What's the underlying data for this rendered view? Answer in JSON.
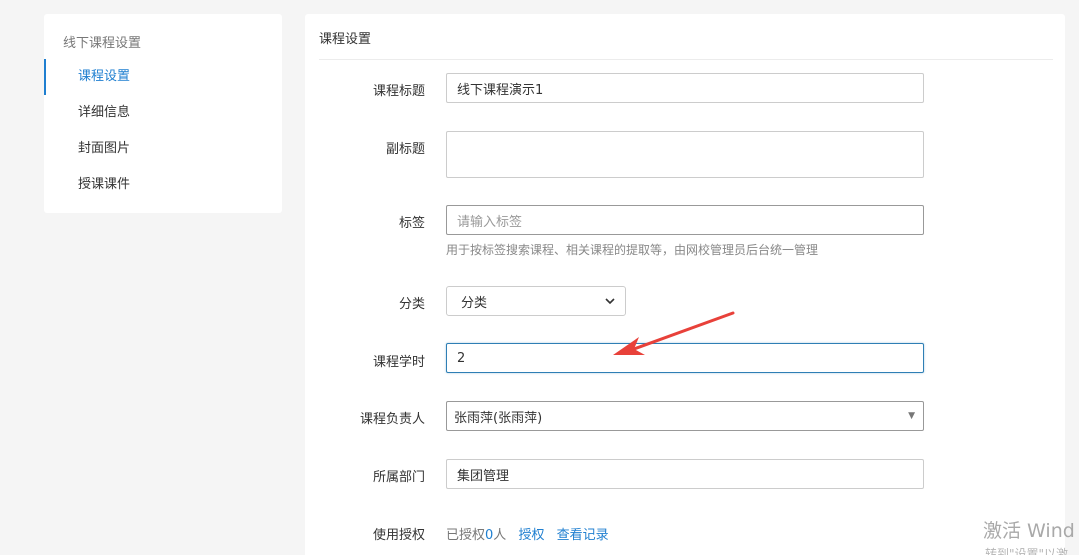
{
  "sidebar": {
    "title": "线下课程设置",
    "items": [
      {
        "label": "课程设置",
        "active": true
      },
      {
        "label": "详细信息"
      },
      {
        "label": "封面图片"
      },
      {
        "label": "授课课件"
      }
    ]
  },
  "main": {
    "header": "课程设置",
    "form": {
      "title_label": "课程标题",
      "title_value": "线下课程演示1",
      "subtitle_label": "副标题",
      "subtitle_value": "",
      "tags_label": "标签",
      "tags_placeholder": "请输入标签",
      "tags_help": "用于按标签搜索课程、相关课程的提取等，由网校管理员后台统一管理",
      "category_label": "分类",
      "category_value": "分类",
      "hours_label": "课程学时",
      "hours_value": "2",
      "owner_label": "课程负责人",
      "owner_value": "张雨萍(张雨萍)",
      "dept_label": "所属部门",
      "dept_value": "集团管理",
      "auth_label": "使用授权",
      "auth_prefix": "已授权",
      "auth_count": "0",
      "auth_suffix": "人",
      "auth_link": "授权",
      "records_link": "查看记录"
    }
  },
  "watermark": {
    "line1": "激活 Wind",
    "line2": "转到\"设置\"以激"
  },
  "colors": {
    "accent": "#1f7fd0",
    "arrow": "#e8413a"
  }
}
